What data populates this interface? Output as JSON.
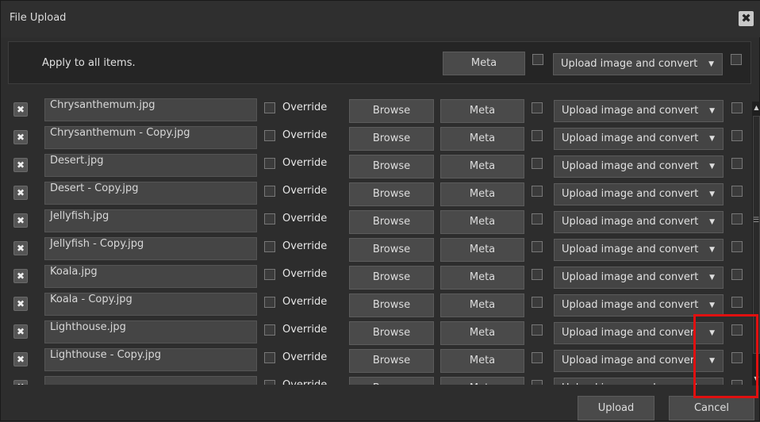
{
  "window": {
    "title": "File Upload",
    "close_symbol": "✖"
  },
  "apply_bar": {
    "label": "Apply to all  items.",
    "meta_label": "Meta",
    "select_value": "Upload image and convert"
  },
  "row_labels": {
    "override": "Override",
    "browse": "Browse",
    "meta": "Meta",
    "remove_symbol": "✖",
    "select_value": "Upload image and convert",
    "select_value_truncated": "Upload image and conver"
  },
  "files": [
    {
      "name": "Chrysanthemum.jpg"
    },
    {
      "name": "Chrysanthemum - Copy.jpg"
    },
    {
      "name": "Desert.jpg"
    },
    {
      "name": "Desert - Copy.jpg"
    },
    {
      "name": "Jellyfish.jpg"
    },
    {
      "name": "Jellyfish - Copy.jpg"
    },
    {
      "name": "Koala.jpg"
    },
    {
      "name": "Koala - Copy.jpg"
    },
    {
      "name": "Lighthouse.jpg"
    },
    {
      "name": "Lighthouse - Copy.jpg"
    },
    {
      "name": ""
    }
  ],
  "footer": {
    "upload_label": "Upload",
    "cancel_label": "Cancel"
  },
  "colors": {
    "background": "#2d2d2d",
    "highlight": "#e01010"
  }
}
